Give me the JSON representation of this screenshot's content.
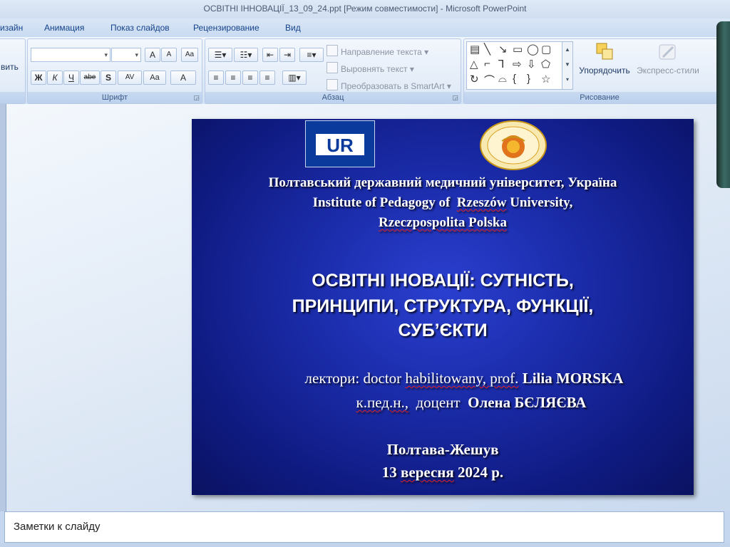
{
  "window": {
    "title": "ОСВІТНІ ІННОВАЦІЇ_13_09_24.ppt [Режим совместимости] - Microsoft PowerPoint"
  },
  "tabs": [
    "изайн",
    "Анимация",
    "Показ слайдов",
    "Рецензирование",
    "Вид"
  ],
  "ribbon": {
    "clipboard_label": "вить",
    "font_group": {
      "label": "Шрифт",
      "grow_font": "A",
      "shrink_font": "A",
      "clear_format": "Aa",
      "bold": "Ж",
      "italic": "К",
      "underline": "Ч",
      "strike": "abe",
      "shadow": "S",
      "spacing": "AV",
      "case": "Aa",
      "color": "A"
    },
    "paragraph_group": {
      "label": "Абзац",
      "text_direction": "Направление текста",
      "align_text": "Выровнять текст",
      "smartart": "Преобразовать в SmartArt"
    },
    "drawing_group": {
      "label": "Рисование",
      "arrange": "Упорядочить",
      "quick_styles": "Экспресс-стили"
    }
  },
  "slide": {
    "logo_text": "UR",
    "university_line1": "Полтавський державний медичний університет, Україна",
    "university_line2_a": "Institute of Pedagogy of",
    "university_line2_b": "Rzeszów",
    "university_line2_c": "University,",
    "university_line3": "Rzeczpospolita Polska",
    "title_line1": "ОСВІТНІ ІНОВАЦІЇ: СУТНІСТЬ,",
    "title_line2": "ПРИНЦИПИ, СТРУКТУРА, ФУНКЦІЇ,",
    "title_line3": "СУБ’ЄКТИ",
    "lecturer1_prefix": "лектори: doctor",
    "lecturer1_degree": "habilitowany, prof.",
    "lecturer1_name": "Lilia MORSKA",
    "lecturer2_degree": "к.пед.н.,",
    "lecturer2_title": "доцент",
    "lecturer2_name": "Олена БЄЛЯЄВА",
    "place": "Полтава-Жешув",
    "date_a": "13",
    "date_b": "вересня",
    "date_c": "2024 р."
  },
  "notes": {
    "placeholder": "Заметки к слайду"
  },
  "colors": {
    "slide_background": "#1a2ba8",
    "ribbon_text": "#15428b"
  }
}
